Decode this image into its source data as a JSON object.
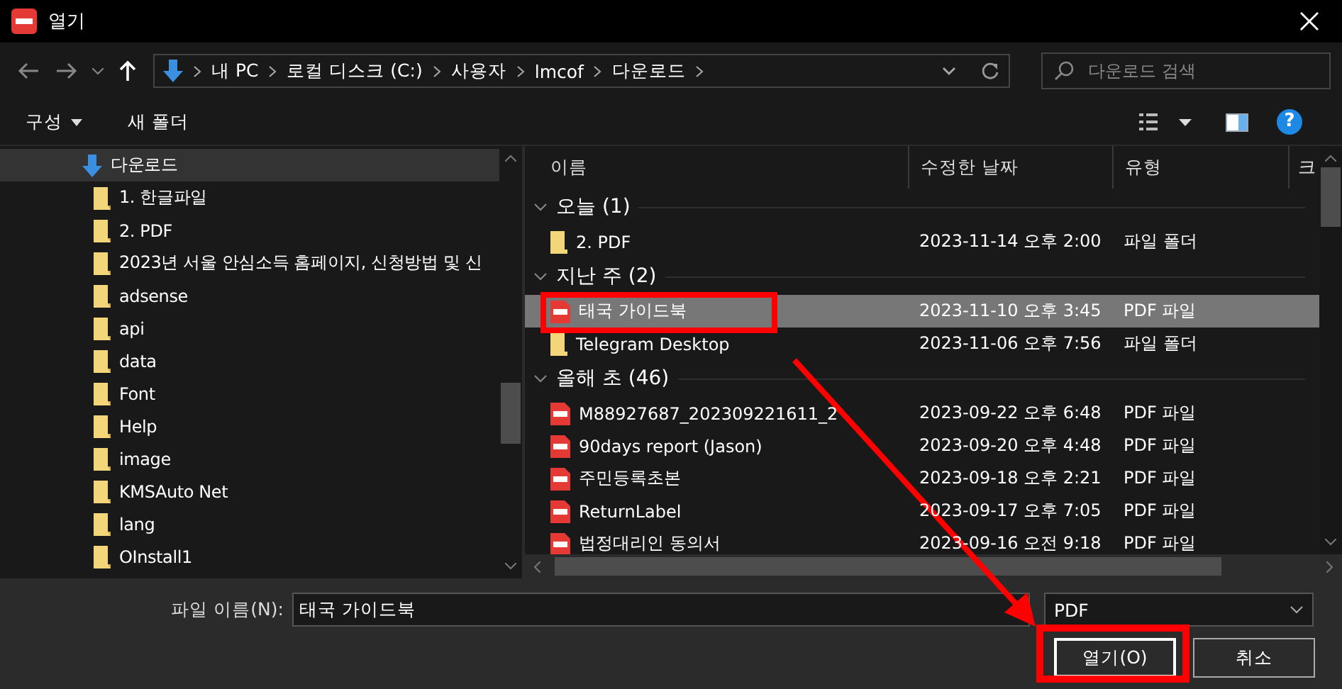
{
  "window": {
    "title": "열기"
  },
  "nav": {
    "path": [
      "내 PC",
      "로컬 디스크 (C:)",
      "사용자",
      "lmcof",
      "다운로드"
    ],
    "search_placeholder": "다운로드 검색"
  },
  "toolbar": {
    "organize": "구성",
    "new_folder": "새 폴더",
    "help": "?"
  },
  "tree": {
    "items": [
      {
        "label": "다운로드",
        "kind": "download",
        "selected": true,
        "children": [
          {
            "label": "1. 한글파일",
            "kind": "folder",
            "selected": false
          },
          {
            "label": "2. PDF",
            "kind": "folder",
            "selected": false
          },
          {
            "label": "2023년 서울 안심소득 홈페이지, 신청방법 및 신",
            "kind": "folder",
            "selected": false
          },
          {
            "label": "adsense",
            "kind": "folder",
            "selected": false
          },
          {
            "label": "api",
            "kind": "folder",
            "selected": false
          },
          {
            "label": "data",
            "kind": "folder",
            "selected": false
          },
          {
            "label": "Font",
            "kind": "folder",
            "selected": false
          },
          {
            "label": "Help",
            "kind": "folder",
            "selected": false
          },
          {
            "label": "image",
            "kind": "folder",
            "selected": false
          },
          {
            "label": "KMSAuto Net",
            "kind": "folder",
            "selected": false
          },
          {
            "label": "lang",
            "kind": "folder",
            "selected": false
          },
          {
            "label": "OInstall1",
            "kind": "folder",
            "selected": false
          }
        ]
      }
    ]
  },
  "files": {
    "columns": [
      "이름",
      "수정한 날짜",
      "유형",
      "크"
    ],
    "groups": [
      {
        "label": "오늘 (1)",
        "expanded": true,
        "rows": [
          {
            "name": "2. PDF",
            "date": "2023-11-14 오후 2:00",
            "type": "파일 폴더",
            "kind": "folder",
            "selected": false
          }
        ]
      },
      {
        "label": "지난 주 (2)",
        "expanded": true,
        "rows": [
          {
            "name": "태국 가이드북",
            "date": "2023-11-10 오후 3:45",
            "type": "PDF 파일",
            "kind": "pdf",
            "selected": true
          },
          {
            "name": "Telegram Desktop",
            "date": "2023-11-06 오후 7:56",
            "type": "파일 폴더",
            "kind": "folder",
            "selected": false
          }
        ]
      },
      {
        "label": "올해 초 (46)",
        "expanded": true,
        "rows": [
          {
            "name": "M88927687_202309221611_2",
            "date": "2023-09-22 오후 6:48",
            "type": "PDF 파일",
            "kind": "pdf",
            "selected": false
          },
          {
            "name": "90days report (Jason)",
            "date": "2023-09-20 오후 4:48",
            "type": "PDF 파일",
            "kind": "pdf",
            "selected": false
          },
          {
            "name": "주민등록초본",
            "date": "2023-09-18 오후 2:21",
            "type": "PDF 파일",
            "kind": "pdf",
            "selected": false
          },
          {
            "name": "ReturnLabel",
            "date": "2023-09-17 오후 7:05",
            "type": "PDF 파일",
            "kind": "pdf",
            "selected": false
          },
          {
            "name": "법정대리인 동의서",
            "date": "2023-09-16 오전 9:18",
            "type": "PDF 파일",
            "kind": "pdf",
            "selected": false
          }
        ]
      }
    ]
  },
  "bottom": {
    "filename_label": "파일 이름(N):",
    "filename": "태국 가이드북",
    "filter": "PDF",
    "open": "열기(O)",
    "cancel": "취소"
  }
}
